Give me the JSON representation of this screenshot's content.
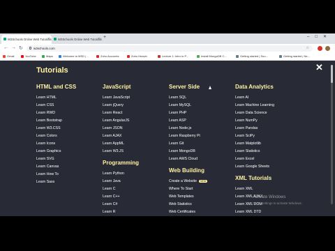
{
  "browser": {
    "tabs": [
      {
        "title": "W3Schools Online Web Tutorials",
        "active": true
      },
      {
        "title": "W3Schools Online Web Tutorials",
        "active": false
      }
    ],
    "url": "w3schools.com",
    "bookmarks": [
      {
        "label": "Gmail",
        "color": "#ea4335"
      },
      {
        "label": "YouTube",
        "color": "#ff0000"
      },
      {
        "label": "Maps",
        "color": "#34a853"
      },
      {
        "label": "Welcome to MSD | ...",
        "color": "#2a7de1"
      },
      {
        "label": "Zoho Accounts",
        "color": "#e42527"
      },
      {
        "label": "Zoho Heavin",
        "color": "#e42527"
      },
      {
        "label": "Lecture 1: Intro to P...",
        "color": "#c0392b"
      },
      {
        "label": "Install MongoDB C...",
        "color": "#4caf50"
      },
      {
        "label": "Getting started | Sou...",
        "color": "#607d8b"
      },
      {
        "label": "Getting started | Ne...",
        "color": "#607d8b"
      }
    ]
  },
  "menu": {
    "title": "Tutorials",
    "close_icon": "✕",
    "columns": [
      {
        "sections": [
          {
            "heading": "HTML and CSS",
            "links": [
              "Learn HTML",
              "Learn CSS",
              "Learn RWD",
              "Learn Bootstrap",
              "Learn W3.CSS",
              "Learn Colors",
              "Learn Icons",
              "Learn Graphics",
              "Learn SVG",
              "Learn Canvas",
              "Learn How To",
              "Learn Sass"
            ]
          }
        ]
      },
      {
        "sections": [
          {
            "heading": "JavaScript",
            "links": [
              "Learn JavaScript",
              "Learn jQuery",
              "Learn React",
              "Learn AngularJS",
              "Learn JSON",
              "Learn AJAX",
              "Learn AppML",
              "Learn W3.JS"
            ]
          },
          {
            "heading": "Programming",
            "links": [
              "Learn Python",
              "Learn Java",
              "Learn C",
              "Learn C++",
              "Learn C#",
              "Learn R"
            ]
          }
        ]
      },
      {
        "sections": [
          {
            "heading": "Server Side",
            "links": [
              "Learn SQL",
              "Learn MySQL",
              "Learn PHP",
              "Learn ASP",
              "Learn Node.js",
              "Learn Raspberry Pi",
              "Learn Git",
              "Learn MongoDB",
              "Learn AWS Cloud"
            ]
          },
          {
            "heading": "Web Building",
            "links": [
              "Create a Website",
              "Where To Start",
              "Web Templates",
              "Web Statistics",
              "Web Certificates"
            ]
          }
        ]
      },
      {
        "sections": [
          {
            "heading": "Data Analytics",
            "links": [
              "Learn AI",
              "Learn Machine Learning",
              "Learn Data Science",
              "Learn NumPy",
              "Learn Pandas",
              "Learn SciPy",
              "Learn Matplotlib",
              "Learn Statistics",
              "Learn Excel",
              "Learn Google Sheets"
            ]
          },
          {
            "heading": "XML Tutorials",
            "links": [
              "Learn XML",
              "Learn XML AJAX",
              "Learn XML DOM",
              "Learn XML DTD"
            ]
          }
        ]
      }
    ],
    "badge": "NEW"
  },
  "watermark": {
    "line1": "Activate Windows",
    "line2": "Go to Settings to activate Windows."
  }
}
